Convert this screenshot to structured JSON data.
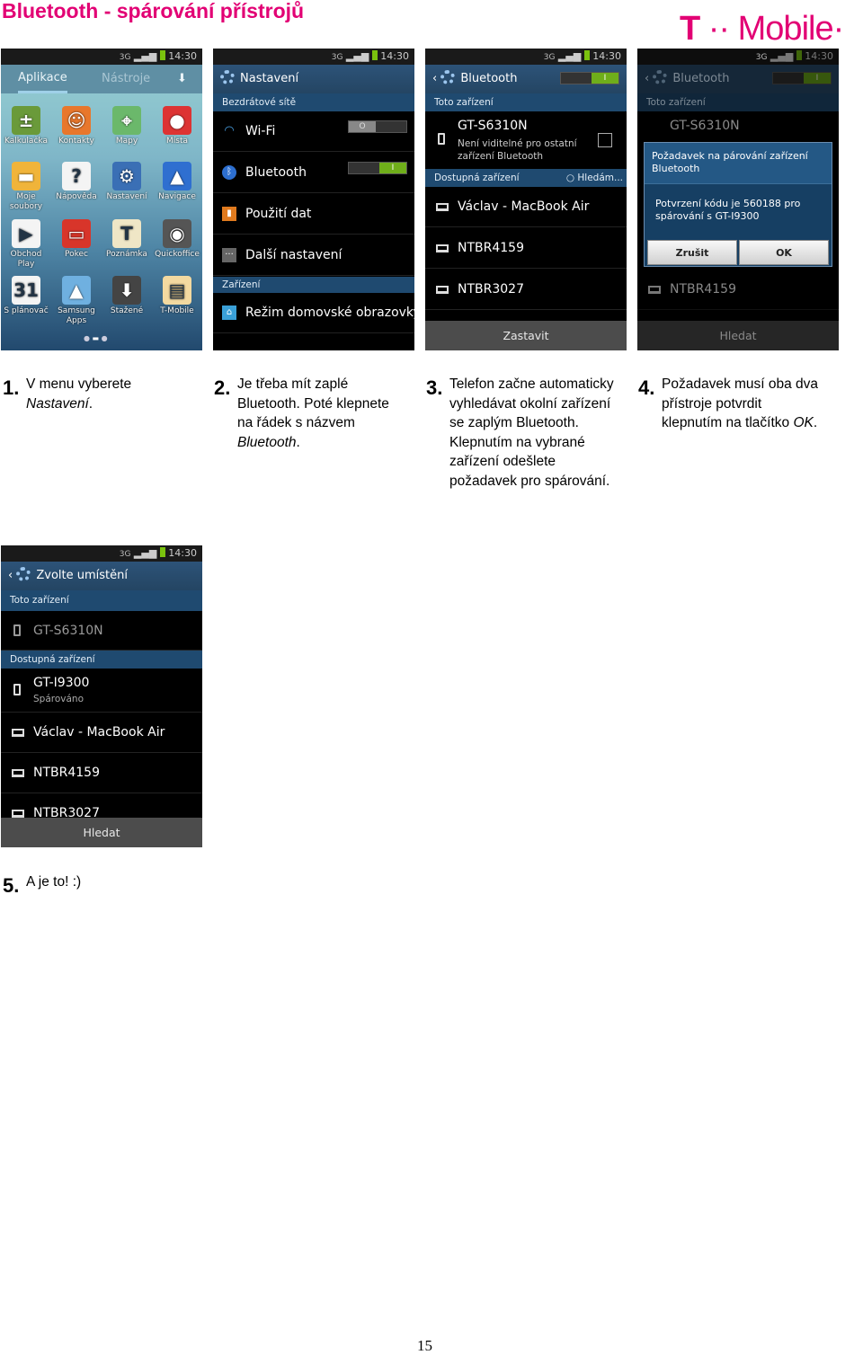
{
  "page_title": "Bluetooth - spárování přístrojů",
  "logo": {
    "text": "T··Mobile·",
    "color": "#e20074"
  },
  "status_bar": {
    "time": "14:30",
    "network": "3G"
  },
  "phone1": {
    "tabs": [
      "Aplikace",
      "Nástroje"
    ],
    "apps": [
      {
        "label": "Kalkulačka",
        "icon": "calculator-icon",
        "color": "#6a9a3a",
        "glyph": "±"
      },
      {
        "label": "Kontakty",
        "icon": "contacts-icon",
        "color": "#e8772c",
        "glyph": "☺"
      },
      {
        "label": "Mapy",
        "icon": "maps-icon",
        "color": "#6bb86b",
        "glyph": "⌖"
      },
      {
        "label": "Místa",
        "icon": "places-icon",
        "color": "#d33",
        "glyph": "●"
      },
      {
        "label": "Moje soubory",
        "icon": "folder-icon",
        "color": "#f0b43a",
        "glyph": "▬"
      },
      {
        "label": "Nápověda",
        "icon": "help-icon",
        "color": "#f4f4f4",
        "glyph": "?"
      },
      {
        "label": "Nastavení",
        "icon": "settings-icon",
        "color": "#3a6fb5",
        "glyph": "⚙"
      },
      {
        "label": "Navigace",
        "icon": "navigation-icon",
        "color": "#2f6fd0",
        "glyph": "▲"
      },
      {
        "label": "Obchod Play",
        "icon": "play-store-icon",
        "color": "#f4f4f4",
        "glyph": "▶"
      },
      {
        "label": "Pokec",
        "icon": "chat-icon",
        "color": "#d8352a",
        "glyph": "▭"
      },
      {
        "label": "Poznámka",
        "icon": "memo-icon",
        "color": "#efe6c6",
        "glyph": "T"
      },
      {
        "label": "Quickoffice",
        "icon": "quickoffice-icon",
        "color": "#555",
        "glyph": "◉"
      },
      {
        "label": "S plánovač",
        "icon": "calendar-icon",
        "color": "#f4f4f4",
        "glyph": "31"
      },
      {
        "label": "Samsung Apps",
        "icon": "samsung-apps-icon",
        "color": "#6fb0e0",
        "glyph": "▲"
      },
      {
        "label": "Stažené",
        "icon": "download-icon",
        "color": "#444",
        "glyph": "⬇"
      },
      {
        "label": "T-Mobile",
        "icon": "tmobile-sim-icon",
        "color": "#f3d9a0",
        "glyph": "▤"
      }
    ]
  },
  "phone2": {
    "header": "Nastavení",
    "section1": "Bezdrátové sítě",
    "rows": [
      "Wi-Fi",
      "Bluetooth",
      "Použití dat",
      "Další nastavení"
    ],
    "wifi_toggle": "O",
    "bt_toggle": "I",
    "section2": "Zařízení",
    "row_home": "Režim domovské obrazovky"
  },
  "phone3": {
    "header": "Bluetooth",
    "toggle": "I",
    "section_this": "Toto zařízení",
    "device_name": "GT-S6310N",
    "device_status": "Není viditelné pro ostatní zařízení Bluetooth",
    "section_available": "Dostupná zařízení",
    "searching": "Hledám...",
    "devices": [
      "Václav - MacBook Air",
      "NTBR4159",
      "NTBR3027"
    ],
    "bottom_button": "Zastavit"
  },
  "phone4": {
    "header": "Bluetooth",
    "section_this": "Toto zařízení",
    "device_name": "GT-S6310N",
    "dialog_title": "Požadavek na párování zařízení Bluetooth",
    "dialog_body": "Potvrzení kódu je 560188 pro spárování s GT-I9300",
    "cancel": "Zrušit",
    "ok": "OK",
    "device_visible": "NTBR4159",
    "bottom_button": "Hledat"
  },
  "phone5": {
    "header": "Zvolte umístění",
    "section_this": "Toto zařízení",
    "device_name": "GT-S6310N",
    "section_available": "Dostupná zařízení",
    "paired_name": "GT-I9300",
    "paired_status": "Spárováno",
    "devices": [
      "Václav - MacBook Air",
      "NTBR4159",
      "NTBR3027"
    ],
    "bottom_button": "Hledat"
  },
  "captions": [
    {
      "num": "1.",
      "text": "V menu vyberete ",
      "em": "Nastavení",
      "tail": "."
    },
    {
      "num": "2.",
      "text": "Je třeba mít zaplé Bluetooth. Poté klepnete na řádek s názvem ",
      "em": "Bluetooth",
      "tail": "."
    },
    {
      "num": "3.",
      "text": "Telefon začne automaticky vyhledávat okolní zařízení se zaplým Bluetooth. Klepnutím na vybrané zařízení odešlete požadavek pro spárování.",
      "em": "",
      "tail": ""
    },
    {
      "num": "4.",
      "text": "Požadavek musí oba dva přístroje potvrdit klepnutím na tlačítko ",
      "em": "OK",
      "tail": "."
    },
    {
      "num": "5.",
      "text": "A je to! :)",
      "em": "",
      "tail": ""
    }
  ],
  "page_number": "15"
}
